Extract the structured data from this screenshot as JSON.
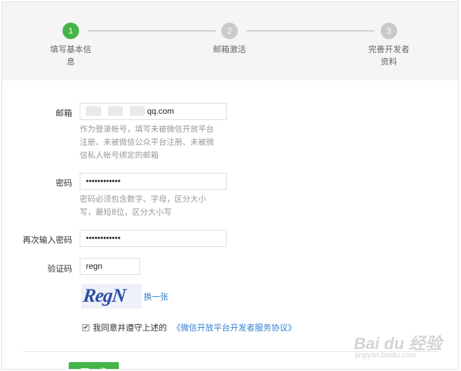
{
  "steps": [
    {
      "number": "1",
      "label_line1": "填写基本信",
      "label_line2": "息"
    },
    {
      "number": "2",
      "label_line1": "邮箱激活",
      "label_line2": ""
    },
    {
      "number": "3",
      "label_line1": "完善开发者",
      "label_line2": "资料"
    }
  ],
  "colors": {
    "accent": "#44b549",
    "step_inactive": "#cacaca",
    "link": "#2f7fd4"
  },
  "form": {
    "email": {
      "label": "邮箱",
      "value_visible": "qq.com",
      "hint_lines": [
        "作为登录帐号，填写未被微信开放平台",
        "注册、未被微信公众平台注册、未被微",
        "信私人帐号绑定的邮箱"
      ]
    },
    "password": {
      "label": "密码",
      "value": "••••••••••••",
      "hint_lines": [
        "密码必须包含数字、字母，区分大小",
        "写，最短8位，区分大小写"
      ]
    },
    "confirm_password": {
      "label": "再次输入密码",
      "value": "••••••••••••"
    },
    "captcha": {
      "label": "验证码",
      "value": "regn",
      "image_text": "RegN",
      "refresh_link": "换一张"
    },
    "agreement": {
      "checked": true,
      "text": "我同意并遵守上述的",
      "link": "《微信开放平台开发者服务协议》"
    }
  },
  "next_button": "下一步",
  "watermark": {
    "logo": "Bai du 经验",
    "sub": "jingyan.baidu.com"
  }
}
